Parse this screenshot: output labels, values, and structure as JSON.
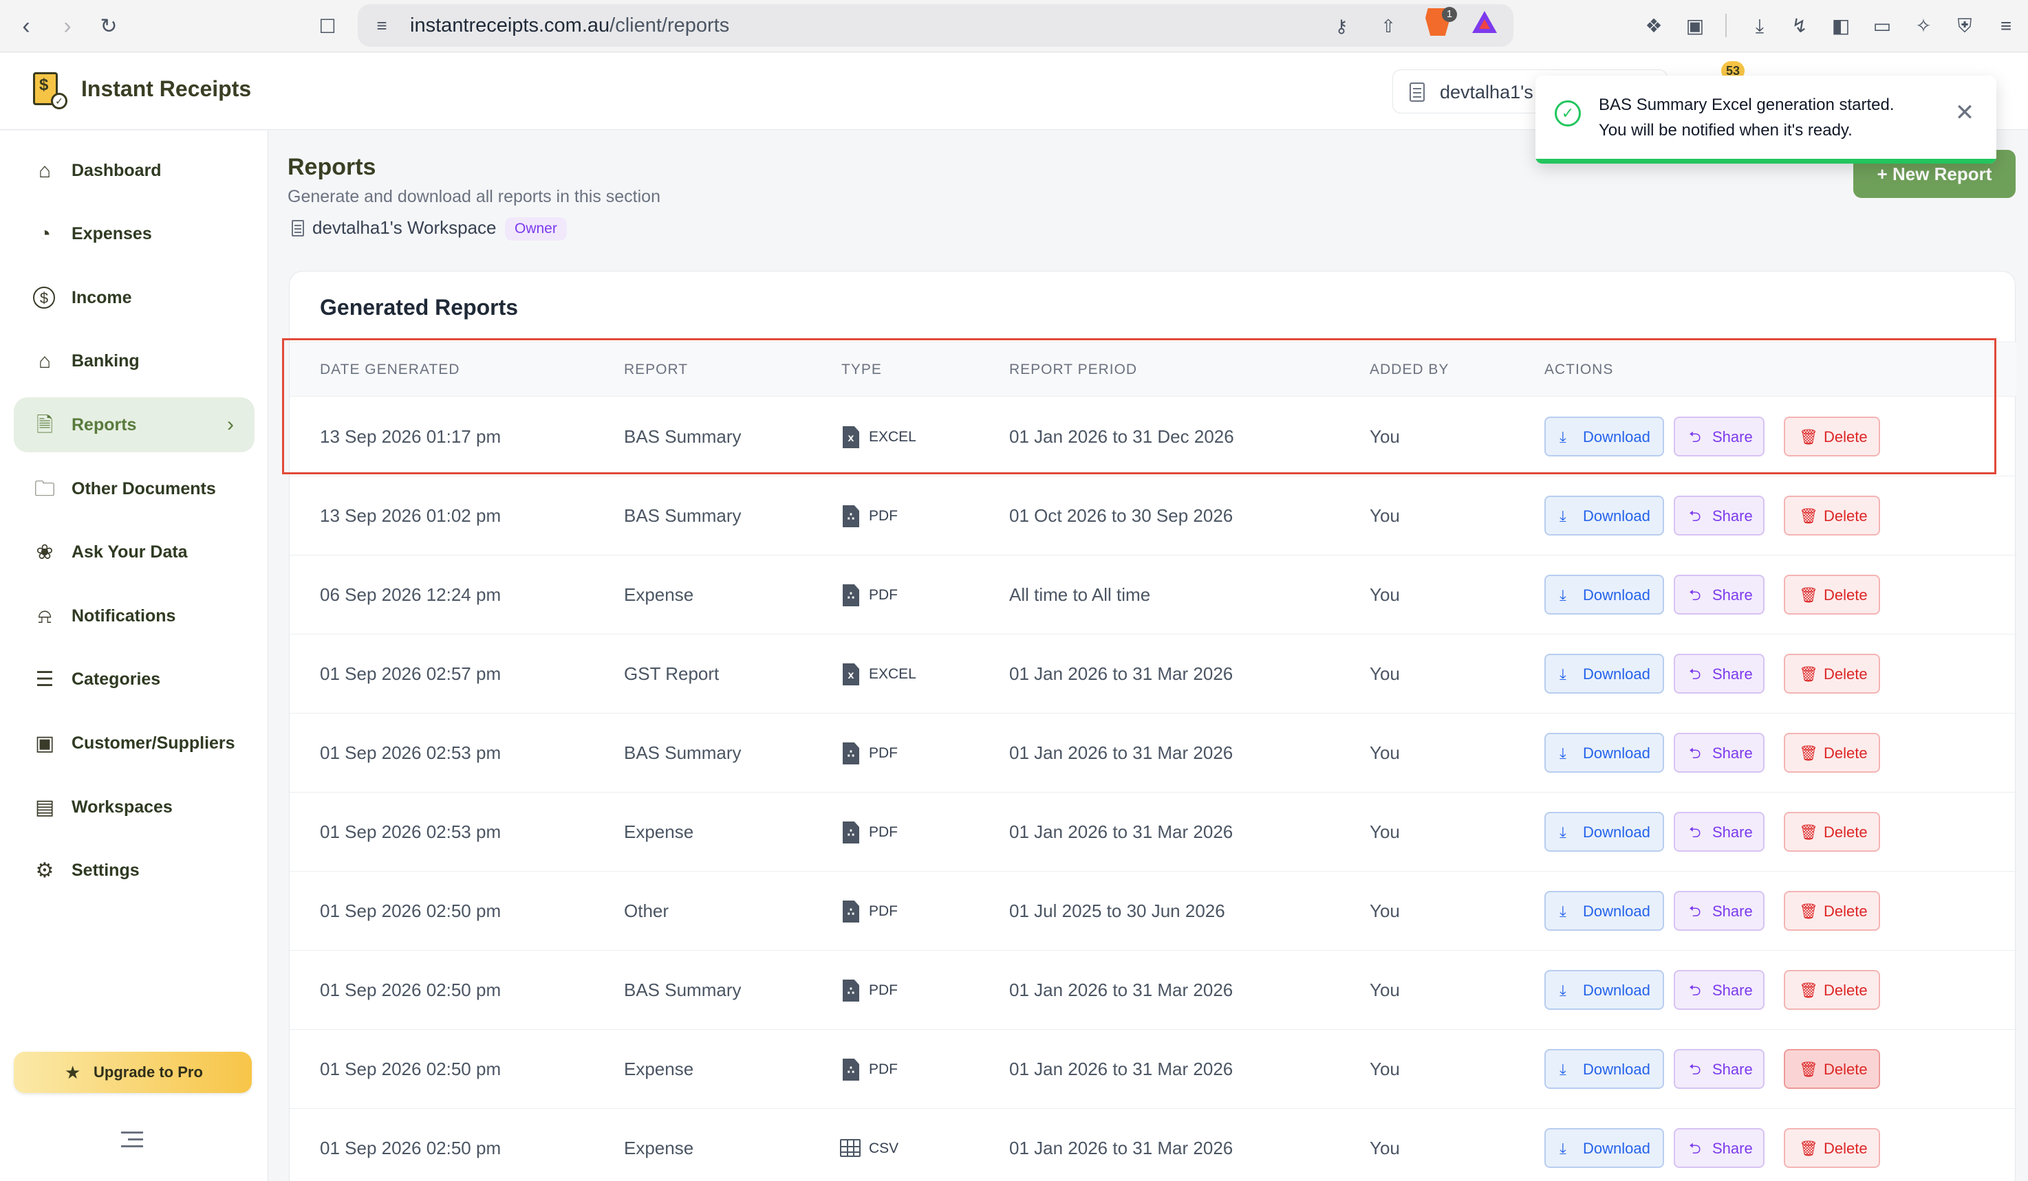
{
  "browser": {
    "url_host": "instantreceipts.com.au",
    "url_path": "/client/reports",
    "brave_badge": "1"
  },
  "app": {
    "name": "Instant Receipts",
    "workspace_pill": "devtalha1's",
    "coin_count": "53"
  },
  "sidebar": {
    "items": [
      {
        "label": "Dashboard",
        "icon": "home-icon"
      },
      {
        "label": "Expenses",
        "icon": "pie-chart-icon"
      },
      {
        "label": "Income",
        "icon": "dollar-circle-icon"
      },
      {
        "label": "Banking",
        "icon": "bank-icon"
      },
      {
        "label": "Reports",
        "icon": "document-icon",
        "active": true
      },
      {
        "label": "Other Documents",
        "icon": "folder-icon"
      },
      {
        "label": "Ask Your Data",
        "icon": "ai-spark-icon"
      },
      {
        "label": "Notifications",
        "icon": "bell-icon"
      },
      {
        "label": "Categories",
        "icon": "categories-icon"
      },
      {
        "label": "Customer/Suppliers",
        "icon": "contacts-icon"
      },
      {
        "label": "Workspaces",
        "icon": "workspace-icon"
      },
      {
        "label": "Settings",
        "icon": "gear-icon"
      }
    ],
    "upgrade_label": "Upgrade to Pro"
  },
  "page": {
    "title": "Reports",
    "subtitle": "Generate and download all reports in this section",
    "workspace_name": "devtalha1's Workspace",
    "role_badge": "Owner",
    "new_report_label": "New Report"
  },
  "card": {
    "title": "Generated Reports",
    "columns": [
      "DATE GENERATED",
      "REPORT",
      "TYPE",
      "REPORT PERIOD",
      "ADDED BY",
      "ACTIONS"
    ],
    "action_labels": {
      "download": "Download",
      "share": "Share",
      "delete": "Delete"
    },
    "rows": [
      {
        "date": "13 Sep 2026 01:17 pm",
        "report": "BAS Summary",
        "type": "EXCEL",
        "period": "01 Jan 2026 to 31 Dec 2026",
        "added_by": "You"
      },
      {
        "date": "13 Sep 2026 01:02 pm",
        "report": "BAS Summary",
        "type": "PDF",
        "period": "01 Oct 2026 to 30 Sep 2026",
        "added_by": "You"
      },
      {
        "date": "06 Sep 2026 12:24 pm",
        "report": "Expense",
        "type": "PDF",
        "period": "All time to All time",
        "added_by": "You"
      },
      {
        "date": "01 Sep 2026 02:57 pm",
        "report": "GST Report",
        "type": "EXCEL",
        "period": "01 Jan 2026 to 31 Mar 2026",
        "added_by": "You"
      },
      {
        "date": "01 Sep 2026 02:53 pm",
        "report": "BAS Summary",
        "type": "PDF",
        "period": "01 Jan 2026 to 31 Mar 2026",
        "added_by": "You"
      },
      {
        "date": "01 Sep 2026 02:53 pm",
        "report": "Expense",
        "type": "PDF",
        "period": "01 Jan 2026 to 31 Mar 2026",
        "added_by": "You"
      },
      {
        "date": "01 Sep 2026 02:50 pm",
        "report": "Other",
        "type": "PDF",
        "period": "01 Jul 2025 to 30 Jun 2026",
        "added_by": "You"
      },
      {
        "date": "01 Sep 2026 02:50 pm",
        "report": "BAS Summary",
        "type": "PDF",
        "period": "01 Jan 2026 to 31 Mar 2026",
        "added_by": "You"
      },
      {
        "date": "01 Sep 2026 02:50 pm",
        "report": "Expense",
        "type": "PDF",
        "period": "01 Jan 2026 to 31 Mar 2026",
        "added_by": "You"
      },
      {
        "date": "01 Sep 2026 02:50 pm",
        "report": "Expense",
        "type": "CSV",
        "period": "01 Jan 2026 to 31 Mar 2026",
        "added_by": "You"
      }
    ]
  },
  "toast": {
    "line1": "BAS Summary Excel generation started.",
    "line2": "You will be notified when it's ready."
  },
  "colors": {
    "accent_green": "#6fa05a",
    "active_nav_bg": "#e6efe3",
    "highlight_red": "#e14a3a",
    "success_green": "#22c55e"
  }
}
